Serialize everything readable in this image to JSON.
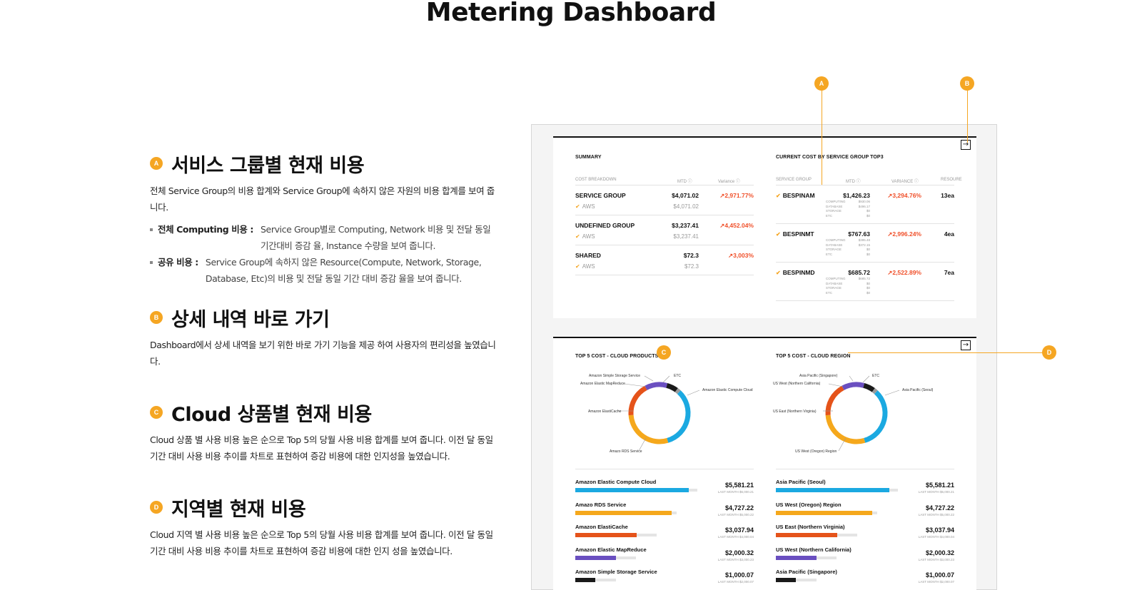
{
  "page_title": "Metering Dashboard",
  "sections": [
    {
      "badge": "A",
      "title": "서비스 그룹별 현재 비용",
      "desc": "전체 Service Group의 비용 합계와 Service Group에 속하지 않은 자원의 비용 합계를 보여 줍니다.",
      "bullets": [
        {
          "label": "전체 Computing 비용 :",
          "text": "Service Group별로 Computing, Network 비용 및 전달 동일 기간대비 증감 율,  Instance 수량을 보여 줍니다."
        },
        {
          "label": "공유 비용 :",
          "text": "Service Group에 속하지 않은 Resource(Compute, Network, Storage, Database, Etc)의 비용 및 전달 동일 기간 대비 증감 율을 보여 줍니다."
        }
      ]
    },
    {
      "badge": "B",
      "title": "상세 내역 바로 가기",
      "desc": "Dashboard에서 상세 내역을 보기 위한 바로 가기 기능을 제공 하여 사용자의 편리성을 높였습니다."
    },
    {
      "badge": "C",
      "title": "Cloud 상품별 현재 비용",
      "desc": "Cloud 상품 별 사용 비용 높은 순으로 Top 5의 당월 사용 비용 합계를 보여 줍니다. 이전 달 동일 기간 대비 사용 비용 추이를 차트로 표현하여 증감 비용에 대한 인지성을 높였습니다."
    },
    {
      "badge": "D",
      "title": "지역별 현재 비용",
      "desc": "Cloud 지역 별 사용 비용 높은 순으로 Top 5의 당월 사용 비용 합계를 보여 줍니다. 이전 달 동일 기간 대비 사용 비용 추이를 차트로 표현하여 증감 비용에 대한 인지 성을 높였습니다."
    }
  ],
  "markers": {
    "a": "A",
    "b": "B",
    "c": "C",
    "d": "D"
  },
  "goto_icon": "→",
  "summary": {
    "title": "SUMMARY",
    "headers": {
      "breakdown": "COST BREAKDOWN",
      "mtd": "MTD ⓘ",
      "variance": "Variance ⓘ"
    },
    "rows": [
      {
        "name": "SERVICE GROUP",
        "mtd": "$4,071.02",
        "variance": "↗2,971.77%",
        "sub": "AWS",
        "sub_mtd": "$4,071.02"
      },
      {
        "name": "UNDEFINED GROUP",
        "mtd": "$3,237.41",
        "variance": "↗4,452.04%",
        "sub": "AWS",
        "sub_mtd": "$3,237.41"
      },
      {
        "name": "SHARED",
        "mtd": "$72.3",
        "variance": "↗3,003%",
        "sub": "AWS",
        "sub_mtd": "$72.3"
      }
    ]
  },
  "top3": {
    "title": "CURRENT COST BY SERVICE GROUP TOP3",
    "headers": {
      "group": "SERVICE GROUP",
      "mtd": "MTD ⓘ",
      "variance": "VARIANCE ⓘ",
      "resource": "RESOURE"
    },
    "rows": [
      {
        "name": "BESPINAM",
        "mtd": "$1,426.23",
        "variance": "↗3,294.76%",
        "resource": "13ea",
        "breakdown": [
          [
            "COMPUTING",
            "$930.06"
          ],
          [
            "DATABASE",
            "$496.17"
          ],
          [
            "STORAGE",
            "$0"
          ],
          [
            "ETC",
            "$0"
          ]
        ]
      },
      {
        "name": "BESPINMT",
        "mtd": "$767.63",
        "variance": "↗2,996.24%",
        "resource": "4ea",
        "breakdown": [
          [
            "COMPUTING",
            "$395.48"
          ],
          [
            "DATABASE",
            "$372.15"
          ],
          [
            "STORAGE",
            "$0"
          ],
          [
            "ETC",
            "$0"
          ]
        ]
      },
      {
        "name": "BESPINMD",
        "mtd": "$685.72",
        "variance": "↗2,522.89%",
        "resource": "7ea",
        "breakdown": [
          [
            "COMPUTING",
            "$685.72"
          ],
          [
            "DATABASE",
            "$0"
          ],
          [
            "STORAGE",
            "$0"
          ],
          [
            "ETC",
            "$0"
          ]
        ]
      }
    ]
  },
  "products": {
    "title": "TOP 5 COST - CLOUD PRODUCTS",
    "donut_labels": {
      "s3": "Amazon Simple Storage Service",
      "emr": "Amazon Elastic MapReduce",
      "etc": "ETC",
      "ec2": "Amazon Elastic Compute Cloud",
      "cache": "Amazon ElastiCache",
      "rds": "Amazo RDS Service"
    },
    "items": [
      {
        "name": "Amazon Elastic Compute Cloud",
        "amount": "$5,581.21",
        "last": "LAST MONTH   $6,000.21"
      },
      {
        "name": "Amazo RDS Service",
        "amount": "$4,727.22",
        "last": "LAST MONTH   $5,000.22"
      },
      {
        "name": "Amazon ElastiCache",
        "amount": "$3,037.94",
        "last": "LAST MONTH   $4,000.04"
      },
      {
        "name": "Amazon Elastic MapReduce",
        "amount": "$2,000.32",
        "last": "LAST MONTH   $3,000.23"
      },
      {
        "name": "Amazon Simple Storage Service",
        "amount": "$1,000.07",
        "last": "LAST MONTH   $2,000.07"
      }
    ]
  },
  "regions": {
    "title": "TOP 5 COST - CLOUD REGION",
    "donut_labels": {
      "sg": "Asia Pacific (Singapore)",
      "nc": "US West (Northern California)",
      "etc": "ETC",
      "seoul": "Asia Pacific (Seoul)",
      "nv": "US East (Northern Virginia)",
      "or": "US West (Oregon) Region"
    },
    "items": [
      {
        "name": "Asia Pacific (Seoul)",
        "amount": "$5,581.21",
        "last": "LAST MONTH   $6,000.21"
      },
      {
        "name": "US West (Oregon) Region",
        "amount": "$4,727.22",
        "last": "LAST MONTH   $5,000.22"
      },
      {
        "name": "US East (Northern Virginia)",
        "amount": "$3,037.94",
        "last": "LAST MONTH   $4,000.04"
      },
      {
        "name": "US West (Northern California)",
        "amount": "$2,000.32",
        "last": "LAST MONTH   $3,000.23"
      },
      {
        "name": "Asia Pacific (Singapore)",
        "amount": "$1,000.07",
        "last": "LAST MONTH   $2,000.07"
      }
    ]
  },
  "colors": {
    "accent": "#f5a623",
    "up": "#f0502a",
    "c1": "#1ba9e1",
    "c2": "#f5a81c",
    "c3": "#e5531a",
    "c4": "#6a4fc0",
    "c5": "#1a1a1a",
    "c6": "#9a9a9a"
  },
  "chart_data": [
    {
      "type": "pie",
      "title": "TOP 5 COST - CLOUD PRODUCTS",
      "categories": [
        "Amazon Elastic Compute Cloud",
        "Amazo RDS Service",
        "Amazon ElastiCache",
        "Amazon Elastic MapReduce",
        "Amazon Simple Storage Service",
        "ETC"
      ],
      "values": [
        5581.21,
        4727.22,
        3037.94,
        2000.32,
        1000.07,
        300
      ]
    },
    {
      "type": "pie",
      "title": "TOP 5 COST - CLOUD REGION",
      "categories": [
        "Asia Pacific (Seoul)",
        "US West (Oregon) Region",
        "US East (Northern Virginia)",
        "US West (Northern California)",
        "Asia Pacific (Singapore)",
        "ETC"
      ],
      "values": [
        5581.21,
        4727.22,
        3037.94,
        2000.32,
        1000.07,
        300
      ]
    },
    {
      "type": "bar",
      "title": "TOP 5 COST - CLOUD PRODUCTS",
      "categories": [
        "Amazon Elastic Compute Cloud",
        "Amazo RDS Service",
        "Amazon ElastiCache",
        "Amazon Elastic MapReduce",
        "Amazon Simple Storage Service"
      ],
      "series": [
        {
          "name": "MTD",
          "values": [
            5581.21,
            4727.22,
            3037.94,
            2000.32,
            1000.07
          ]
        },
        {
          "name": "LAST MONTH",
          "values": [
            6000.21,
            5000.22,
            4000.04,
            3000.23,
            2000.07
          ]
        }
      ]
    },
    {
      "type": "bar",
      "title": "TOP 5 COST - CLOUD REGION",
      "categories": [
        "Asia Pacific (Seoul)",
        "US West (Oregon) Region",
        "US East (Northern Virginia)",
        "US West (Northern California)",
        "Asia Pacific (Singapore)"
      ],
      "series": [
        {
          "name": "MTD",
          "values": [
            5581.21,
            4727.22,
            3037.94,
            2000.32,
            1000.07
          ]
        },
        {
          "name": "LAST MONTH",
          "values": [
            6000.21,
            5000.22,
            4000.04,
            3000.23,
            2000.07
          ]
        }
      ]
    }
  ]
}
